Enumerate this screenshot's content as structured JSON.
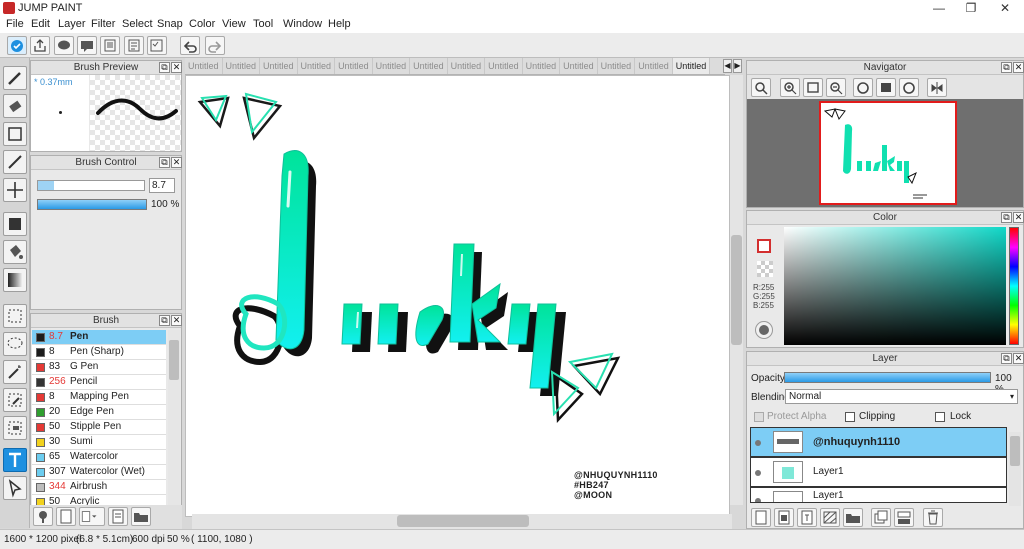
{
  "app": {
    "title": "JUMP PAINT"
  },
  "menu": [
    "File",
    "Edit",
    "Layer",
    "Filter",
    "Select",
    "Snap",
    "Color",
    "View",
    "Tool",
    "Window",
    "Help"
  ],
  "tabs": {
    "inactive_label": "Untitled",
    "count": 14,
    "active_label": "Untitled"
  },
  "panels": {
    "brush_preview": {
      "title": "Brush Preview",
      "size_label": "* 0.37mm"
    },
    "brush_control": {
      "title": "Brush Control",
      "size_value": "8.7",
      "opacity_value": "100 %"
    },
    "brush": {
      "title": "Brush",
      "items": [
        {
          "size": "8.7",
          "name": "Pen",
          "color": "#1c1c1c",
          "size_red": false
        },
        {
          "size": "8",
          "name": "Pen (Sharp)",
          "color": "#1c1c1c",
          "size_red": false
        },
        {
          "size": "83",
          "name": "G Pen",
          "color": "#e53935",
          "size_red": false
        },
        {
          "size": "256",
          "name": "Pencil",
          "color": "#333333",
          "size_red": true
        },
        {
          "size": "8",
          "name": "Mapping Pen",
          "color": "#e53935",
          "size_red": false
        },
        {
          "size": "20",
          "name": "Edge Pen",
          "color": "#2e9e2e",
          "size_red": false
        },
        {
          "size": "50",
          "name": "Stipple Pen",
          "color": "#e53935",
          "size_red": false
        },
        {
          "size": "30",
          "name": "Sumi",
          "color": "#f2d21e",
          "size_red": false
        },
        {
          "size": "65",
          "name": "Watercolor",
          "color": "#6ccdf0",
          "size_red": false
        },
        {
          "size": "307",
          "name": "Watercolor (Wet)",
          "color": "#6ccdf0",
          "size_red": false
        },
        {
          "size": "344",
          "name": "Airbrush",
          "color": "#bdbdbd",
          "size_red": true
        },
        {
          "size": "50",
          "name": "Acrylic",
          "color": "#f2d21e",
          "size_red": false
        }
      ]
    },
    "navigator": {
      "title": "Navigator"
    },
    "color": {
      "title": "Color",
      "r": "R:255",
      "g": "G:255",
      "b": "B:255"
    },
    "layer": {
      "title": "Layer",
      "opacity_label": "Opacity",
      "opacity_value": "100 %",
      "blending_label": "Blending",
      "blending_value": "Normal",
      "protect_alpha": "Protect Alpha",
      "clipping": "Clipping",
      "lock": "Lock",
      "layers": [
        "@nhuquynh1110",
        "Layer1",
        "Layer1"
      ]
    }
  },
  "artwork": {
    "signature_lines": [
      "@NHUQUYNH1110",
      "#HB247",
      "@MOON"
    ]
  },
  "status": {
    "dimensions": "1600 * 1200 pixel",
    "physical": "(6.8 * 5.1cm)",
    "dpi": "600 dpi",
    "zoom": "50 %",
    "coords": "( 1100, 1080 )"
  },
  "colors": {
    "accent": "#1e90e0",
    "teal": "#00e0a8",
    "cyan": "#18e8e0",
    "selected_layer": "#7dcdf5"
  }
}
